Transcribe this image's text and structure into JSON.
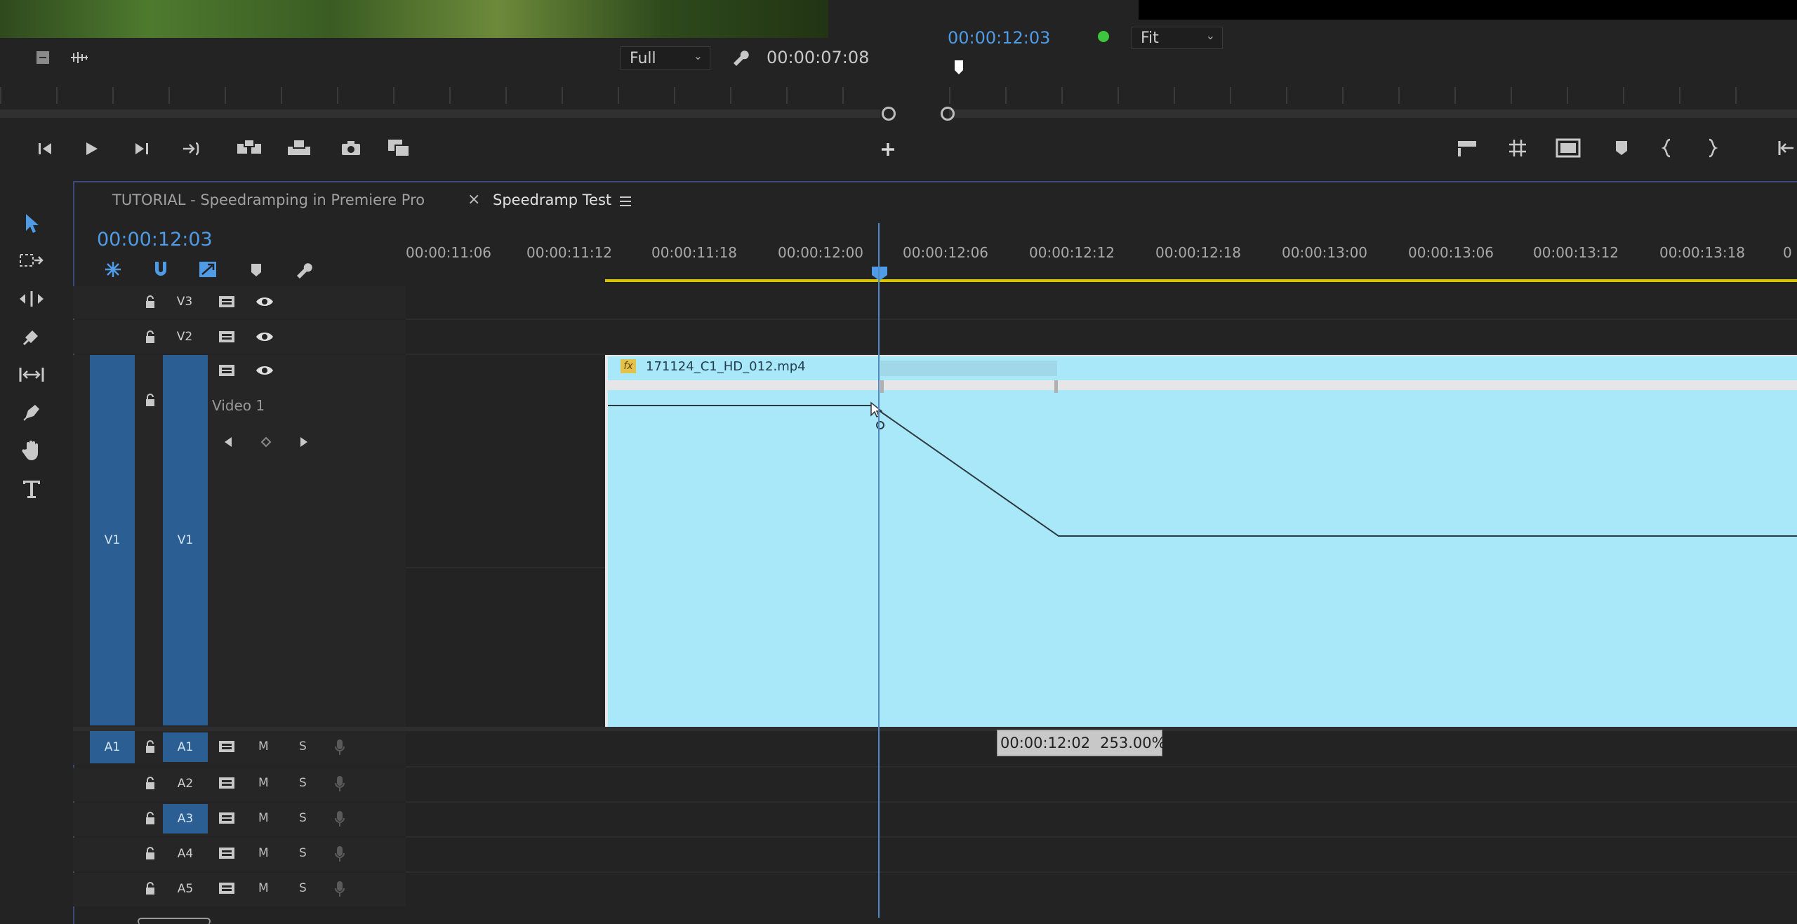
{
  "source_monitor": {
    "zoom": "Full",
    "timecode": "00:00:07:08"
  },
  "program_monitor": {
    "timecode": "00:00:12:03",
    "zoom": "Fit"
  },
  "sequence_tabs": [
    {
      "label": "TUTORIAL - Speedramping in Premiere Pro",
      "active": false
    },
    {
      "label": "Speedramp Test",
      "active": true
    }
  ],
  "timeline": {
    "timecode": "00:00:12:03",
    "ruler_labels": [
      "00:00:11:06",
      "00:00:11:12",
      "00:00:11:18",
      "00:00:12:00",
      "00:00:12:06",
      "00:00:12:12",
      "00:00:12:18",
      "00:00:13:00",
      "00:00:13:06",
      "00:00:13:12",
      "00:00:13:18",
      "0"
    ],
    "video_tracks": [
      {
        "target": "",
        "name": "V3",
        "label": ""
      },
      {
        "target": "",
        "name": "V2",
        "label": ""
      },
      {
        "target": "V1",
        "name": "V1",
        "label": "Video 1"
      }
    ],
    "audio_tracks": [
      {
        "target": "A1",
        "name": "A1",
        "m": "M",
        "s": "S"
      },
      {
        "target": "",
        "name": "A2",
        "m": "M",
        "s": "S"
      },
      {
        "target": "",
        "name": "A3",
        "m": "M",
        "s": "S"
      },
      {
        "target": "",
        "name": "A4",
        "m": "M",
        "s": "S"
      },
      {
        "target": "",
        "name": "A5",
        "m": "M",
        "s": "S"
      }
    ],
    "clip": {
      "name": "171124_C1_HD_012.mp4",
      "fx_badge": "fx"
    },
    "tooltip": {
      "timecode": "00:00:12:02",
      "speed": "253.00%"
    }
  },
  "tools": [
    "selection-tool",
    "track-select-tool",
    "ripple-edit-tool",
    "razor-tool",
    "slip-tool",
    "pen-tool",
    "hand-tool",
    "type-tool"
  ],
  "colors": {
    "accent_blue": "#4f9be6",
    "clip_fill": "#a8e8f8",
    "target_blue": "#2b5e93",
    "work_area_yellow": "#d8c400"
  }
}
